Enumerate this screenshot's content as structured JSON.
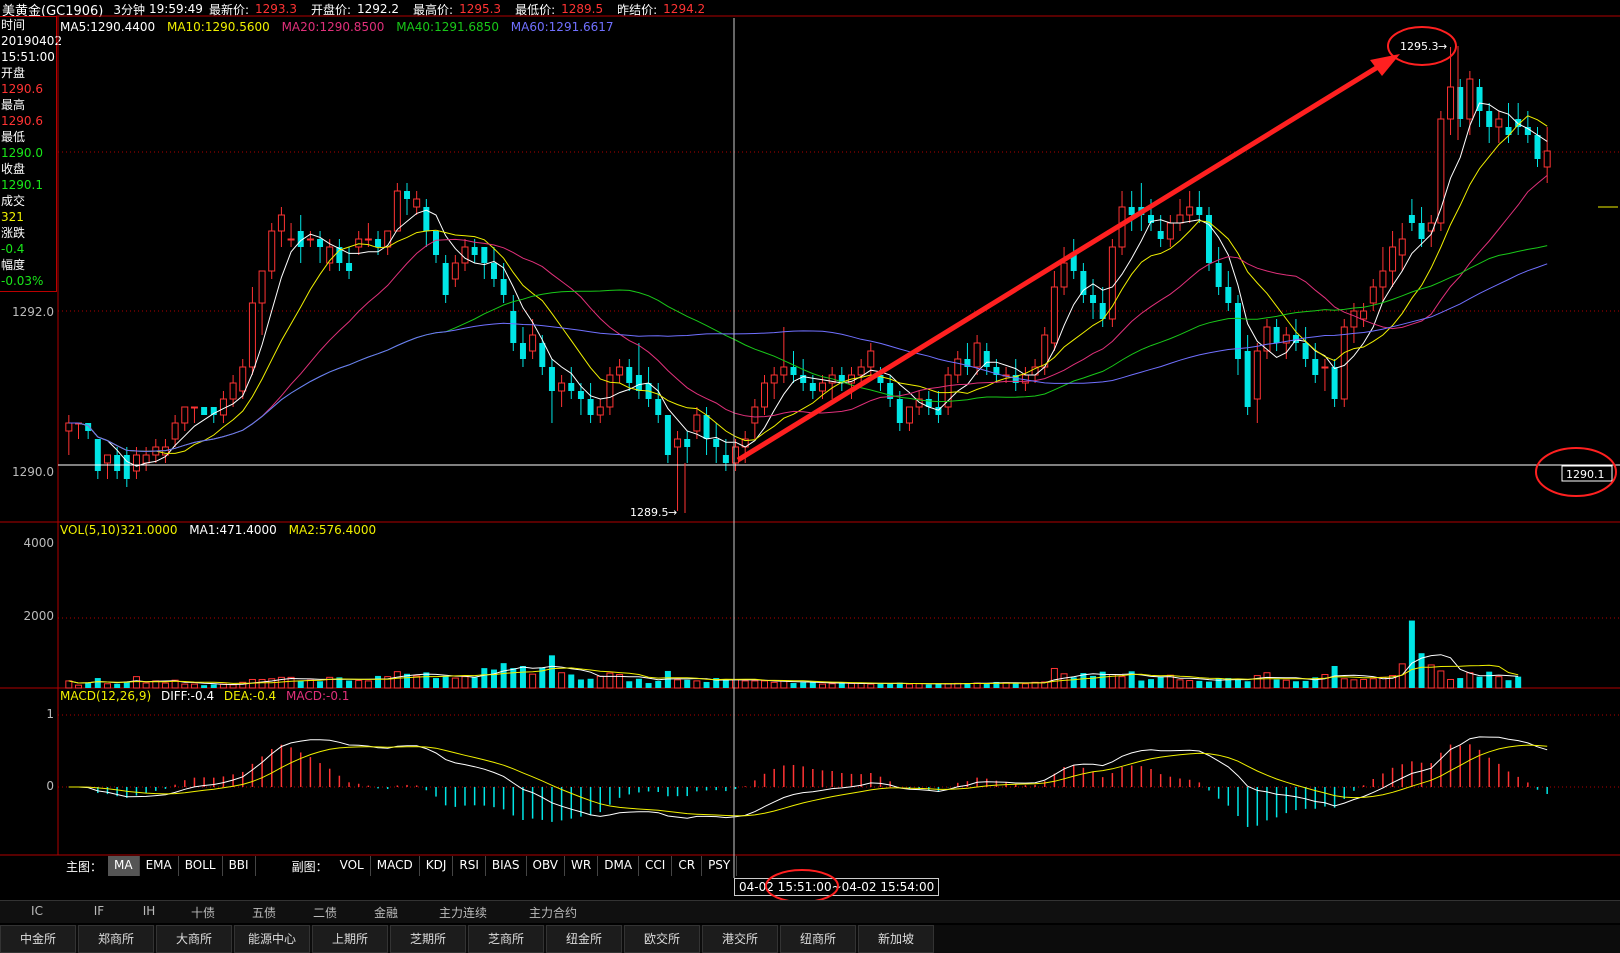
{
  "header": {
    "symbol": "美黄金(GC1906)",
    "period": "3分钟",
    "time": "19:59:49",
    "latest_label": "最新价:",
    "latest_value": "1293.3",
    "open_label": "开盘价:",
    "open_value": "1292.2",
    "high_label": "最高价:",
    "high_value": "1295.3",
    "low_label": "最低价:",
    "low_value": "1289.5",
    "prev_label": "昨结价:",
    "prev_value": "1294.2"
  },
  "info_panel": {
    "time_label": "时间",
    "date": "20190402",
    "clock": "15:51:00",
    "open_label": "开盘",
    "open": "1290.6",
    "high_label": "最高",
    "high": "1290.6",
    "low_label": "最低",
    "low": "1290.0",
    "close_label": "收盘",
    "close": "1290.1",
    "vol_label": "成交",
    "vol": "321",
    "chg_label": "涨跌",
    "chg": "-0.4",
    "pct_label": "幅度",
    "pct": "-0.03%"
  },
  "ma_legend": {
    "ma5": "MA5:1290.4400",
    "ma10": "MA10:1290.5600",
    "ma20": "MA20:1290.8500",
    "ma40": "MA40:1291.6850",
    "ma60": "MA60:1291.6617"
  },
  "price_axis": {
    "upper": "1292.0",
    "lower": "1290.0"
  },
  "annotations": {
    "high_marker": "1295.3",
    "low_marker": "1289.5",
    "last_price_tag": "1290.1"
  },
  "vol_legend": {
    "vol": "VOL(5,10)321.0000",
    "ma1": "MA1:471.4000",
    "ma2": "MA2:576.4000"
  },
  "vol_axis": {
    "upper": "4000",
    "lower": "2000"
  },
  "macd_legend": {
    "macd": "MACD(12,26,9)",
    "diff": "DIFF:-0.4",
    "dea": "DEA:-0.4",
    "macd_val": "MACD:-0.1"
  },
  "macd_axis": {
    "upper": "1",
    "zero": "0"
  },
  "main_buttons": {
    "caption": "主图：",
    "items": [
      "MA",
      "EMA",
      "BOLL",
      "BBI"
    ],
    "selected": "MA"
  },
  "sub_buttons": {
    "caption": "副图：",
    "items": [
      "VOL",
      "MACD",
      "KDJ",
      "RSI",
      "BIAS",
      "OBV",
      "WR",
      "DMA",
      "CCI",
      "CR",
      "PSY"
    ]
  },
  "time_range": {
    "start": "04-02 15:51:00",
    "end": "~04-02 15:54:00"
  },
  "categories": [
    "IC",
    "IF",
    "IH",
    "十债",
    "五债",
    "二债",
    "金融",
    "主力连续",
    "主力合约"
  ],
  "exchanges": [
    "中金所",
    "郑商所",
    "大商所",
    "能源中心",
    "上期所",
    "芝期所",
    "芝商所",
    "纽金所",
    "欧交所",
    "港交所",
    "纽商所",
    "新加坡"
  ],
  "colors": {
    "up": "#ff3333",
    "down": "#00e5e5",
    "ma5": "#ffffff",
    "ma10": "#f0f000",
    "ma20": "#e0307a",
    "ma40": "#19c819",
    "ma60": "#7070ff",
    "grid": "#b00000"
  },
  "chart_data": {
    "type": "candlestick",
    "candles_ohlc": [
      [
        1290.5,
        1290.7,
        1290.2,
        1290.6
      ],
      [
        1290.6,
        1290.6,
        1290.4,
        1290.6
      ],
      [
        1290.6,
        1290.6,
        1290.4,
        1290.5
      ],
      [
        1290.4,
        1290.4,
        1289.9,
        1290.0
      ],
      [
        1290.1,
        1290.2,
        1289.9,
        1290.2
      ],
      [
        1290.2,
        1290.3,
        1289.9,
        1290.0
      ],
      [
        1290.2,
        1290.3,
        1289.8,
        1289.9
      ],
      [
        1290.0,
        1290.3,
        1289.9,
        1290.2
      ],
      [
        1290.1,
        1290.3,
        1290.0,
        1290.2
      ],
      [
        1290.2,
        1290.4,
        1290.1,
        1290.3
      ],
      [
        1290.2,
        1290.4,
        1290.1,
        1290.3
      ],
      [
        1290.4,
        1290.7,
        1290.3,
        1290.6
      ],
      [
        1290.6,
        1290.8,
        1290.5,
        1290.8
      ],
      [
        1290.8,
        1290.8,
        1290.6,
        1290.8
      ],
      [
        1290.8,
        1290.8,
        1290.7,
        1290.7
      ],
      [
        1290.8,
        1290.8,
        1290.6,
        1290.7
      ],
      [
        1290.7,
        1291.0,
        1290.6,
        1290.9
      ],
      [
        1290.9,
        1291.2,
        1290.8,
        1291.1
      ],
      [
        1291.0,
        1291.4,
        1290.9,
        1291.3
      ],
      [
        1291.3,
        1292.3,
        1291.2,
        1292.1
      ],
      [
        1292.1,
        1292.5,
        1291.7,
        1292.5
      ],
      [
        1292.5,
        1293.1,
        1292.4,
        1293.0
      ],
      [
        1293.0,
        1293.3,
        1292.8,
        1293.2
      ],
      [
        1292.9,
        1293.1,
        1292.8,
        1292.9
      ],
      [
        1293.0,
        1293.2,
        1292.6,
        1292.8
      ],
      [
        1292.9,
        1293.0,
        1292.8,
        1292.9
      ],
      [
        1292.9,
        1293.0,
        1292.6,
        1292.8
      ],
      [
        1292.6,
        1292.9,
        1292.5,
        1292.8
      ],
      [
        1292.8,
        1292.9,
        1292.5,
        1292.6
      ],
      [
        1292.6,
        1292.8,
        1292.4,
        1292.5
      ],
      [
        1292.8,
        1293.0,
        1292.7,
        1292.9
      ],
      [
        1292.9,
        1293.1,
        1292.8,
        1292.9
      ],
      [
        1292.9,
        1293.0,
        1292.7,
        1292.8
      ],
      [
        1292.8,
        1293.0,
        1292.7,
        1293.0
      ],
      [
        1293.0,
        1293.6,
        1293.0,
        1293.5
      ],
      [
        1293.5,
        1293.6,
        1293.2,
        1293.4
      ],
      [
        1293.3,
        1293.5,
        1293.2,
        1293.4
      ],
      [
        1293.3,
        1293.4,
        1292.8,
        1293.0
      ],
      [
        1293.0,
        1293.0,
        1292.6,
        1292.7
      ],
      [
        1292.6,
        1292.7,
        1292.1,
        1292.2
      ],
      [
        1292.4,
        1292.7,
        1292.3,
        1292.6
      ],
      [
        1292.6,
        1292.9,
        1292.5,
        1292.8
      ],
      [
        1292.8,
        1292.9,
        1292.6,
        1292.7
      ],
      [
        1292.8,
        1292.8,
        1292.4,
        1292.6
      ],
      [
        1292.6,
        1292.8,
        1292.3,
        1292.4
      ],
      [
        1292.4,
        1292.6,
        1292.1,
        1292.2
      ],
      [
        1292.0,
        1292.2,
        1291.5,
        1291.6
      ],
      [
        1291.6,
        1291.8,
        1291.3,
        1291.4
      ],
      [
        1291.5,
        1291.9,
        1291.4,
        1291.7
      ],
      [
        1291.6,
        1291.7,
        1291.2,
        1291.3
      ],
      [
        1291.3,
        1291.4,
        1290.6,
        1291.0
      ],
      [
        1291.0,
        1291.2,
        1290.8,
        1291.1
      ],
      [
        1291.1,
        1291.3,
        1290.9,
        1291.0
      ],
      [
        1291.0,
        1291.1,
        1290.7,
        1290.9
      ],
      [
        1290.9,
        1291.1,
        1290.6,
        1290.7
      ],
      [
        1290.7,
        1290.9,
        1290.6,
        1290.8
      ],
      [
        1290.8,
        1291.3,
        1290.7,
        1291.2
      ],
      [
        1291.2,
        1291.4,
        1291.1,
        1291.3
      ],
      [
        1291.3,
        1291.4,
        1291.0,
        1291.1
      ],
      [
        1291.2,
        1291.6,
        1290.9,
        1291.0
      ],
      [
        1291.1,
        1291.3,
        1290.8,
        1290.9
      ],
      [
        1290.9,
        1291.1,
        1290.6,
        1290.7
      ],
      [
        1290.7,
        1290.7,
        1290.1,
        1290.2
      ],
      [
        1290.3,
        1290.5,
        1289.5,
        1290.4
      ],
      [
        1290.4,
        1290.5,
        1290.1,
        1290.3
      ],
      [
        1290.5,
        1290.8,
        1290.4,
        1290.7
      ],
      [
        1290.7,
        1290.8,
        1290.2,
        1290.4
      ],
      [
        1290.4,
        1290.6,
        1290.1,
        1290.3
      ],
      [
        1290.2,
        1290.4,
        1290.0,
        1290.1
      ],
      [
        1290.1,
        1290.4,
        1290.0,
        1290.3
      ],
      [
        1290.3,
        1290.5,
        1290.1,
        1290.4
      ],
      [
        1290.6,
        1290.9,
        1290.4,
        1290.8
      ],
      [
        1290.8,
        1291.2,
        1290.7,
        1291.1
      ],
      [
        1291.1,
        1291.3,
        1290.9,
        1291.2
      ],
      [
        1291.2,
        1291.8,
        1291.1,
        1291.3
      ],
      [
        1291.3,
        1291.5,
        1291.1,
        1291.2
      ],
      [
        1291.2,
        1291.4,
        1291.0,
        1291.1
      ],
      [
        1291.1,
        1291.2,
        1290.9,
        1291.0
      ],
      [
        1291.0,
        1291.2,
        1290.9,
        1291.1
      ],
      [
        1291.1,
        1291.3,
        1290.9,
        1291.2
      ],
      [
        1291.2,
        1291.3,
        1291.0,
        1291.1
      ],
      [
        1291.1,
        1291.3,
        1290.9,
        1291.2
      ],
      [
        1291.2,
        1291.4,
        1291.1,
        1291.3
      ],
      [
        1291.3,
        1291.6,
        1291.2,
        1291.5
      ],
      [
        1291.2,
        1291.3,
        1291.0,
        1291.1
      ],
      [
        1291.1,
        1291.2,
        1290.8,
        1290.9
      ],
      [
        1290.9,
        1291.0,
        1290.5,
        1290.6
      ],
      [
        1290.6,
        1290.8,
        1290.5,
        1290.8
      ],
      [
        1290.8,
        1291.0,
        1290.7,
        1290.9
      ],
      [
        1290.9,
        1291.0,
        1290.7,
        1290.8
      ],
      [
        1290.8,
        1291.0,
        1290.6,
        1290.7
      ],
      [
        1290.8,
        1291.3,
        1290.7,
        1291.2
      ],
      [
        1291.2,
        1291.5,
        1291.1,
        1291.4
      ],
      [
        1291.4,
        1291.6,
        1291.2,
        1291.3
      ],
      [
        1291.3,
        1291.7,
        1291.2,
        1291.6
      ],
      [
        1291.5,
        1291.6,
        1291.2,
        1291.3
      ],
      [
        1291.3,
        1291.4,
        1291.1,
        1291.2
      ],
      [
        1291.2,
        1291.3,
        1291.1,
        1291.2
      ],
      [
        1291.2,
        1291.4,
        1291.0,
        1291.1
      ],
      [
        1291.1,
        1291.3,
        1291.0,
        1291.2
      ],
      [
        1291.2,
        1291.4,
        1291.1,
        1291.3
      ],
      [
        1291.3,
        1291.8,
        1291.2,
        1291.7
      ],
      [
        1291.6,
        1292.5,
        1291.5,
        1292.3
      ],
      [
        1292.3,
        1292.8,
        1292.2,
        1292.6
      ],
      [
        1292.7,
        1292.9,
        1292.4,
        1292.5
      ],
      [
        1292.5,
        1292.6,
        1292.1,
        1292.2
      ],
      [
        1292.2,
        1292.4,
        1291.9,
        1292.1
      ],
      [
        1292.1,
        1292.3,
        1291.8,
        1291.9
      ],
      [
        1291.9,
        1292.9,
        1291.8,
        1292.8
      ],
      [
        1292.8,
        1293.5,
        1292.7,
        1293.3
      ],
      [
        1293.3,
        1293.5,
        1293.0,
        1293.2
      ],
      [
        1293.3,
        1293.6,
        1293.0,
        1293.2
      ],
      [
        1293.2,
        1293.4,
        1293.0,
        1293.1
      ],
      [
        1293.0,
        1293.2,
        1292.8,
        1292.9
      ],
      [
        1292.9,
        1293.2,
        1292.8,
        1293.1
      ],
      [
        1293.1,
        1293.4,
        1293.0,
        1293.2
      ],
      [
        1293.2,
        1293.5,
        1293.1,
        1293.3
      ],
      [
        1293.3,
        1293.5,
        1293.1,
        1293.2
      ],
      [
        1293.2,
        1293.3,
        1292.5,
        1292.6
      ],
      [
        1292.6,
        1292.8,
        1292.2,
        1292.3
      ],
      [
        1292.3,
        1292.5,
        1292.0,
        1292.1
      ],
      [
        1292.1,
        1292.2,
        1291.2,
        1291.4
      ],
      [
        1291.5,
        1291.7,
        1290.7,
        1290.8
      ],
      [
        1290.9,
        1291.6,
        1290.6,
        1291.5
      ],
      [
        1291.5,
        1291.9,
        1291.4,
        1291.8
      ],
      [
        1291.8,
        1291.9,
        1291.5,
        1291.6
      ],
      [
        1291.6,
        1291.8,
        1291.4,
        1291.7
      ],
      [
        1291.7,
        1291.9,
        1291.5,
        1291.6
      ],
      [
        1291.6,
        1291.8,
        1291.3,
        1291.4
      ],
      [
        1291.4,
        1291.6,
        1291.1,
        1291.2
      ],
      [
        1291.3,
        1291.4,
        1291.0,
        1291.3
      ],
      [
        1291.3,
        1291.4,
        1290.8,
        1290.9
      ],
      [
        1290.9,
        1291.9,
        1290.8,
        1291.8
      ],
      [
        1291.8,
        1292.1,
        1291.6,
        1292.0
      ],
      [
        1291.9,
        1292.1,
        1291.8,
        1292.0
      ],
      [
        1292.1,
        1292.4,
        1292.0,
        1292.3
      ],
      [
        1292.3,
        1292.8,
        1292.1,
        1292.5
      ],
      [
        1292.5,
        1293.0,
        1292.3,
        1292.8
      ],
      [
        1292.7,
        1293.1,
        1292.5,
        1292.9
      ],
      [
        1293.2,
        1293.4,
        1293.0,
        1293.1
      ],
      [
        1293.1,
        1293.3,
        1292.8,
        1292.9
      ],
      [
        1293.0,
        1293.2,
        1292.8,
        1293.1
      ],
      [
        1293.1,
        1294.5,
        1293.0,
        1294.4
      ],
      [
        1294.4,
        1295.3,
        1294.2,
        1294.8
      ],
      [
        1294.8,
        1294.9,
        1294.3,
        1294.4
      ],
      [
        1294.4,
        1295.0,
        1294.2,
        1294.9
      ],
      [
        1294.8,
        1294.9,
        1294.3,
        1294.5
      ],
      [
        1294.5,
        1294.6,
        1294.1,
        1294.3
      ],
      [
        1294.3,
        1294.5,
        1294.1,
        1294.4
      ],
      [
        1294.3,
        1294.6,
        1294.1,
        1294.2
      ],
      [
        1294.4,
        1294.6,
        1294.2,
        1294.3
      ],
      [
        1294.3,
        1294.5,
        1294.1,
        1294.2
      ],
      [
        1294.2,
        1294.3,
        1293.8,
        1293.9
      ],
      [
        1293.8,
        1294.3,
        1293.6,
        1294.0
      ]
    ],
    "volumes": [
      200,
      80,
      160,
      280,
      120,
      120,
      180,
      320,
      140,
      200,
      140,
      220,
      110,
      110,
      80,
      100,
      110,
      90,
      160,
      240,
      240,
      260,
      300,
      300,
      200,
      220,
      190,
      300,
      300,
      210,
      210,
      200,
      340,
      320,
      460,
      400,
      340,
      440,
      280,
      340,
      280,
      320,
      300,
      560,
      520,
      700,
      560,
      620,
      390,
      580,
      920,
      430,
      380,
      240,
      260,
      330,
      420,
      380,
      190,
      260,
      140,
      200,
      480,
      230,
      230,
      200,
      170,
      280,
      250,
      240,
      200,
      200,
      200,
      160,
      200,
      140,
      160,
      170,
      110,
      120,
      140,
      130,
      130,
      110,
      140,
      120,
      150,
      110,
      120,
      100,
      130,
      120,
      130,
      140,
      140,
      140,
      170,
      150,
      140,
      120,
      160,
      170,
      550,
      400,
      300,
      420,
      340,
      460,
      380,
      320,
      470,
      210,
      250,
      310,
      360,
      230,
      210,
      200,
      180,
      280,
      280,
      250,
      190,
      350,
      430,
      240,
      220,
      190,
      200,
      300,
      380,
      620,
      260,
      230,
      240,
      260,
      300,
      350,
      680,
      1900,
      980,
      650,
      480,
      240,
      280,
      430,
      320,
      460,
      320,
      220,
      320
    ],
    "volume_axis": [
      0,
      4000
    ],
    "price_axis_labels": [
      "1290.0",
      "1292.0"
    ],
    "macd_axis_labels": [
      "0",
      "1"
    ],
    "time_range": [
      "04-02 15:51:00",
      "04-02 15:54:00"
    ]
  }
}
